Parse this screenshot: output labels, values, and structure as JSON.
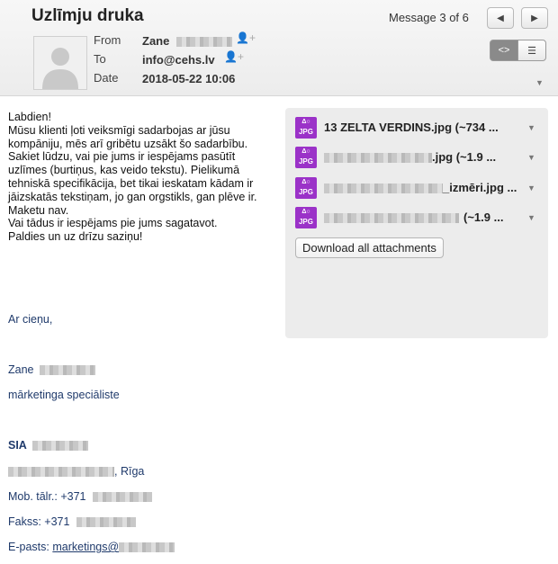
{
  "header": {
    "subject": "Uzlīmju druka",
    "message_count": "Message 3 of 6",
    "from_label": "From",
    "from_value": "Zane",
    "to_label": "To",
    "to_value": "info@cehs.lv",
    "date_label": "Date",
    "date_value": "2018-05-22 10:06",
    "nav_prev_icon": "chevron-left-icon",
    "nav_next_icon": "chevron-right-icon"
  },
  "body": {
    "text": "Labdien!\nMūsu klienti ļoti veiksmīgi sadarbojas ar jūsu kompāniju, mēs arī gribētu uzsākt šo sadarbību.\nSakiet lūdzu, vai pie jums ir iespējams pasūtīt uzlīmes (burtiņus, kas veido tekstu). Pielikumā tehniskā specifikācija, bet tikai ieskatam kādam ir jāizskatās tekstiņam, jo gan orgstikls, gan plēve ir.  Maketu nav.\nVai tādus ir iespējams pie jums sagatavot.\nPaldies un uz drīzu saziņu!"
  },
  "signature": {
    "closing": "Ar  cieņu,",
    "name": "Zane",
    "role": "mārketinga speciāliste",
    "company": "SIA",
    "city": ", Rīga",
    "phone": "Mob. tālr.: +371",
    "fax": "Fakss: +371",
    "email_label": "E-pasts:",
    "email_link": "marketings@"
  },
  "attachments": {
    "items": [
      {
        "name": "13 ZELTA VERDINS.jpg (~734 ...",
        "icon": "jpg-file-icon"
      },
      {
        "name": ".jpg (~1.9 ...",
        "icon": "jpg-file-icon"
      },
      {
        "name": "_izmēri.jpg ...",
        "icon": "jpg-file-icon"
      },
      {
        "name": "(~1.9 ...",
        "icon": "jpg-file-icon"
      }
    ],
    "file_type_label": "JPG",
    "download_all": "Download all attachments"
  },
  "colors": {
    "jpg_icon": "#9b32c8",
    "signature_text": "#1f3a6b",
    "attachment_panel": "#ececec"
  }
}
